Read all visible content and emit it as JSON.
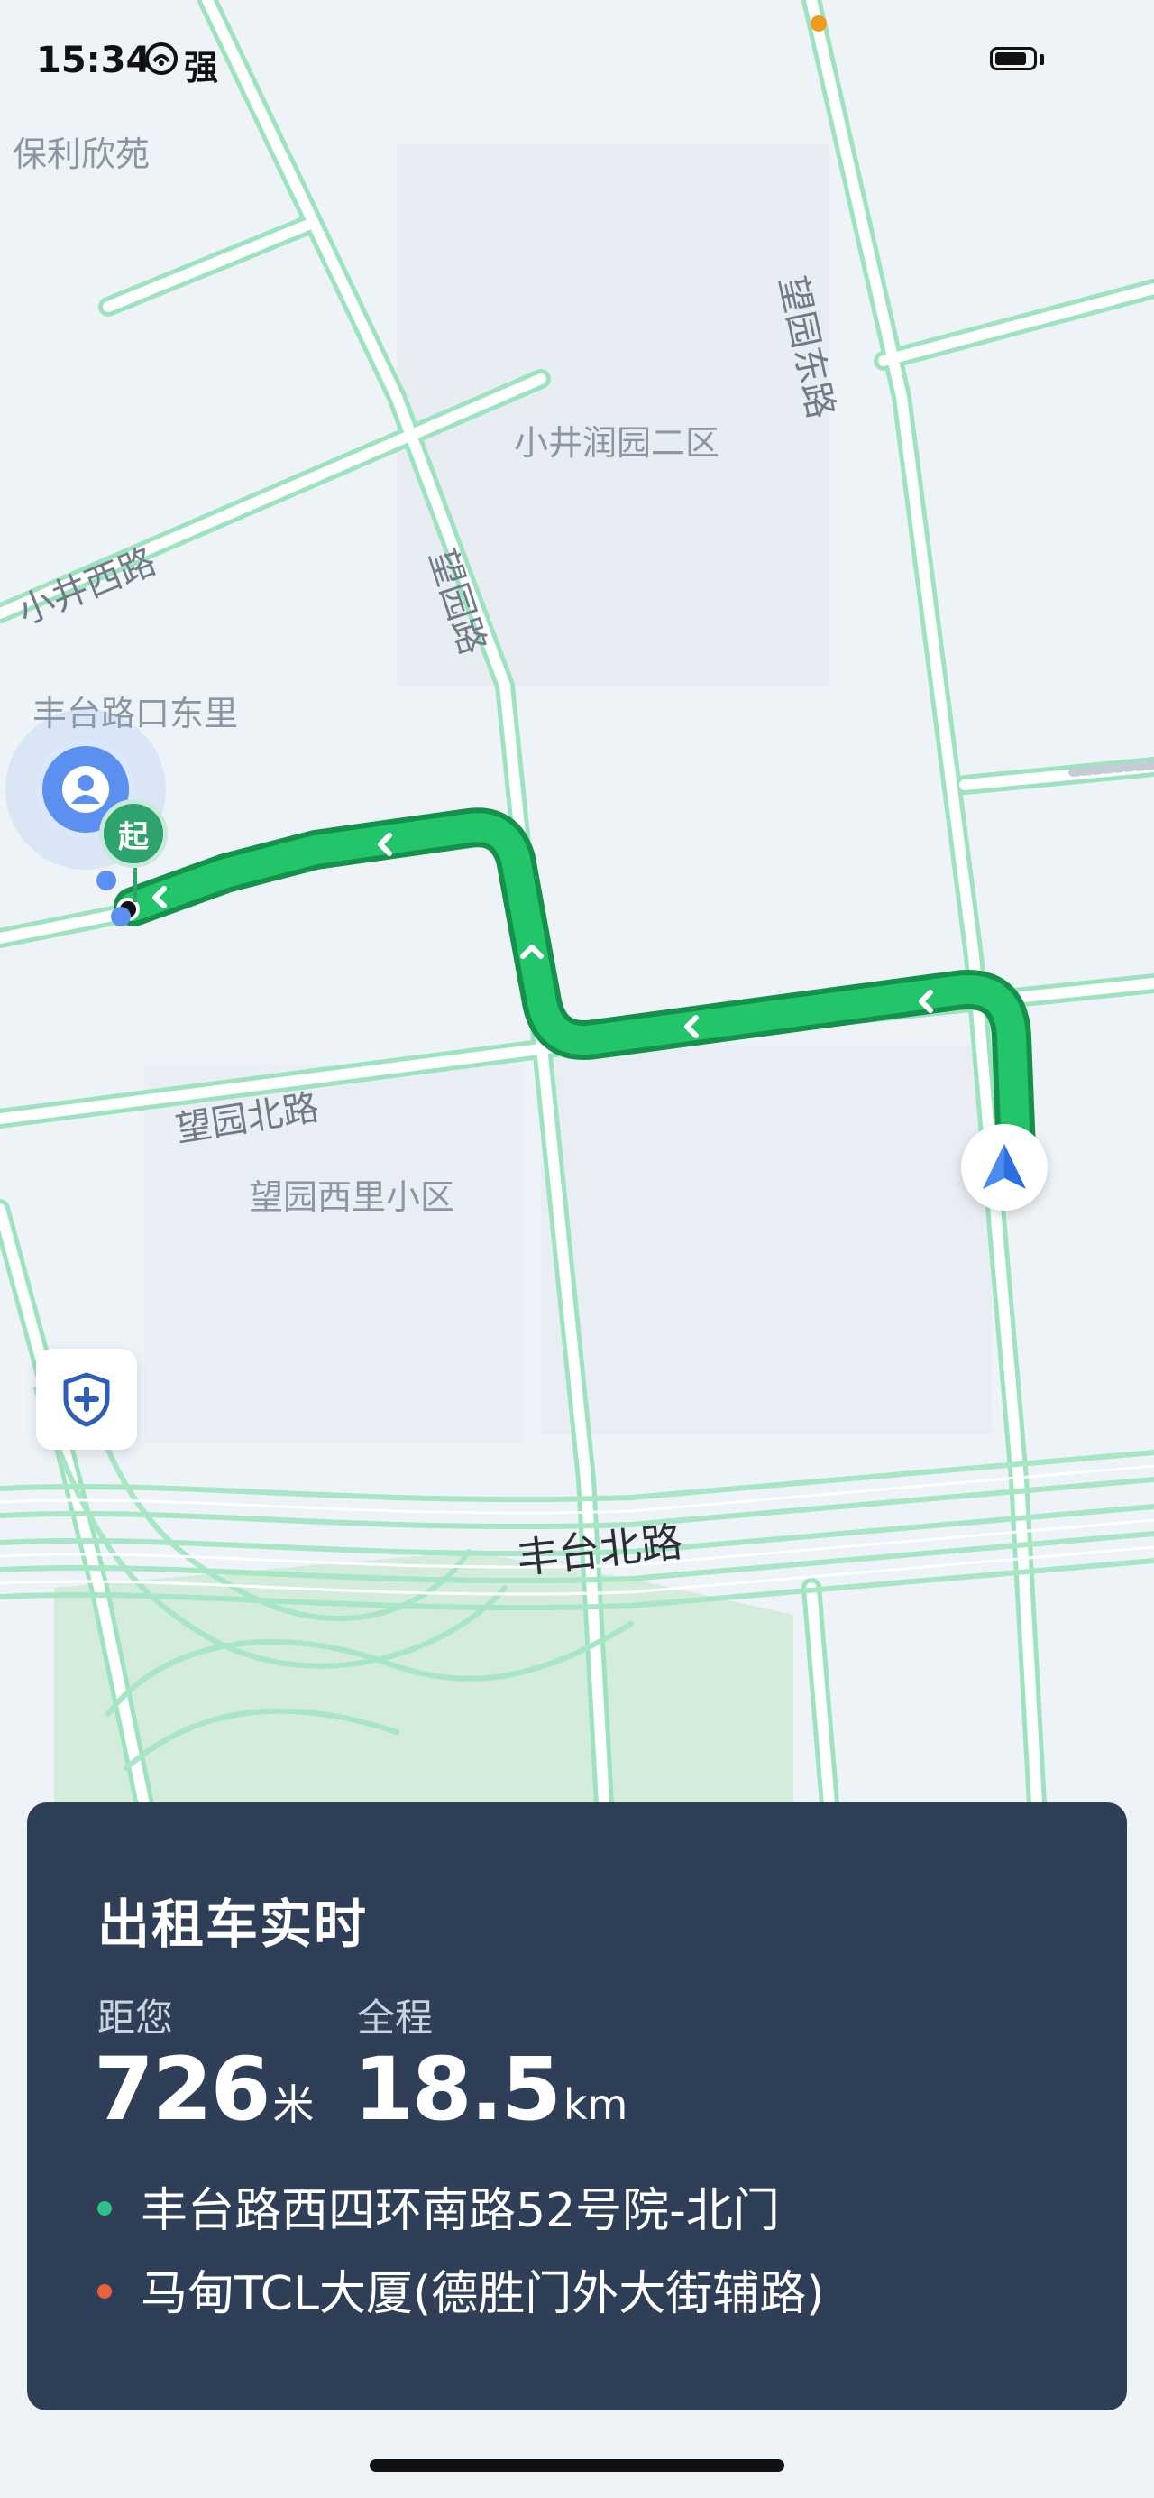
{
  "status_bar": {
    "time": "15:34",
    "signal_text": "强",
    "battery_level": 0.85
  },
  "map": {
    "place_labels": [
      "保利欣苑",
      "小井润园二区",
      "丰台路口东里",
      "望园西里小区"
    ],
    "road_labels": [
      "望园东路",
      "小井西路",
      "望园路",
      "望园北路",
      "丰台北路"
    ],
    "start_label": "起",
    "colors": {
      "route": "#23c56b",
      "route_outline": "#14914b",
      "road": "#9ee3c0"
    }
  },
  "panel": {
    "title": "出租车实时",
    "distance_label": "距您",
    "distance_value": "726",
    "distance_unit": "米",
    "total_label": "全程",
    "total_value": "18.5",
    "total_unit": "km",
    "origin": "丰台路西四环南路52号院-北门",
    "destination": "马甸TCL大厦(德胜门外大街辅路)",
    "origin_color": "#2fc08a",
    "destination_color": "#e8613a"
  },
  "icons": [
    "user-location-icon",
    "shield-plus-icon",
    "navigation-arrow-icon"
  ]
}
